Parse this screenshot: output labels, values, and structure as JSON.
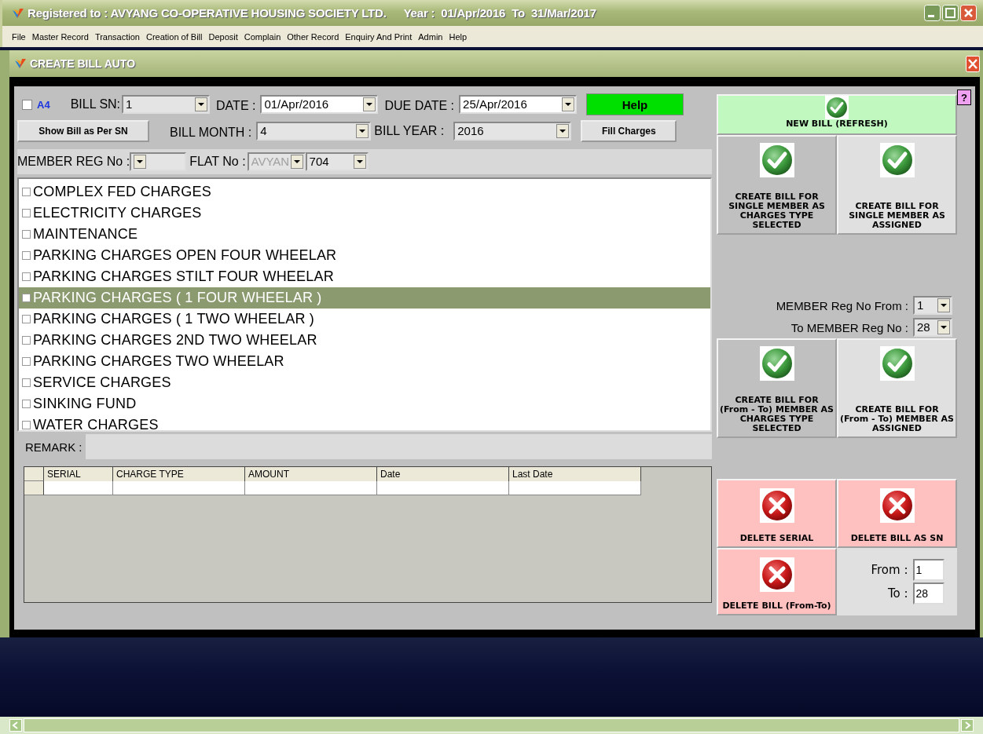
{
  "window": {
    "title": "Registered to : AVYANG CO-OPERATIVE HOUSING SOCIETY LTD.",
    "year": "Year :  01/Apr/2016  To  31/Mar/2017"
  },
  "menu": [
    "File",
    "Master Record",
    "Transaction",
    "Creation of Bill",
    "Deposit",
    "Complain",
    "Other Record",
    "Enquiry And Print",
    "Admin",
    "Help"
  ],
  "child_window": {
    "title": "CREATE BILL AUTO"
  },
  "a4": {
    "label": "A4",
    "checked": false
  },
  "bill_sn": {
    "label": "BILL SN:",
    "value": "1"
  },
  "date": {
    "label": "DATE :",
    "value": "01/Apr/2016"
  },
  "due_date": {
    "label": "DUE DATE :",
    "value": "25/Apr/2016"
  },
  "help_button": "Help",
  "show_bill_button": "Show Bill as Per SN",
  "bill_month": {
    "label": "BILL MONTH :",
    "value": "4"
  },
  "bill_year": {
    "label": "BILL YEAR :",
    "value": "2016"
  },
  "fill_charges_button": "Fill Charges",
  "member_reg_no": {
    "label": "MEMBER REG No :"
  },
  "flat_no": {
    "label": "FLAT No :",
    "prefix": "AVYAN",
    "prefix_disabled": true,
    "value": "704"
  },
  "charges": [
    {
      "label": "COMPLEX FED CHARGES",
      "checked": false,
      "selected": false
    },
    {
      "label": "ELECTRICITY CHARGES",
      "checked": false,
      "selected": false
    },
    {
      "label": "MAINTENANCE",
      "checked": false,
      "selected": false
    },
    {
      "label": "PARKING CHARGES  OPEN FOUR WHEELAR",
      "checked": false,
      "selected": false
    },
    {
      "label": "PARKING CHARGES  STILT FOUR WHEELAR",
      "checked": false,
      "selected": false
    },
    {
      "label": "PARKING CHARGES ( 1 FOUR WHEELAR )",
      "checked": false,
      "selected": true
    },
    {
      "label": "PARKING CHARGES ( 1 TWO WHEELAR )",
      "checked": false,
      "selected": false
    },
    {
      "label": "PARKING CHARGES 2ND TWO WHEELAR",
      "checked": false,
      "selected": false
    },
    {
      "label": "PARKING CHARGES TWO WHEELAR",
      "checked": false,
      "selected": false
    },
    {
      "label": "SERVICE CHARGES",
      "checked": false,
      "selected": false
    },
    {
      "label": "SINKING FUND",
      "checked": false,
      "selected": false
    },
    {
      "label": "WATER CHARGES",
      "checked": false,
      "selected": false
    }
  ],
  "remark": {
    "label": "REMARK :"
  },
  "grid": {
    "columns": [
      "SERIAL",
      "CHARGE TYPE",
      "AMOUNT",
      "Date",
      "Last Date"
    ]
  },
  "help_icon": "?",
  "new_bill_button": {
    "label": "NEW BILL (REFRESH)",
    "kind": "check"
  },
  "single_buttons": [
    {
      "label": "CREATE BILL FOR SINGLE MEMBER AS CHARGES TYPE SELECTED",
      "kind": "check"
    },
    {
      "label": "CREATE BILL FOR SINGLE MEMBER AS ASSIGNED",
      "kind": "check"
    }
  ],
  "member_from": {
    "label": "MEMBER Reg No From :",
    "value": "1"
  },
  "member_to": {
    "label": "To MEMBER Reg No :",
    "value": "28"
  },
  "range_buttons": [
    {
      "label": "CREATE BILL FOR (From - To) MEMBER AS CHARGES TYPE SELECTED",
      "kind": "check"
    },
    {
      "label": "CREATE BILL FOR (From - To) MEMBER AS ASSIGNED",
      "kind": "check"
    }
  ],
  "delete_buttons": [
    {
      "label": "DELETE SERIAL",
      "kind": "cross"
    },
    {
      "label": "DELETE BILL AS SN",
      "kind": "cross"
    },
    {
      "label": "DELETE BILL (From-To)",
      "kind": "cross"
    }
  ],
  "delete_from": {
    "label": "From :",
    "value": "1"
  },
  "delete_to": {
    "label": "To :",
    "value": "28"
  }
}
